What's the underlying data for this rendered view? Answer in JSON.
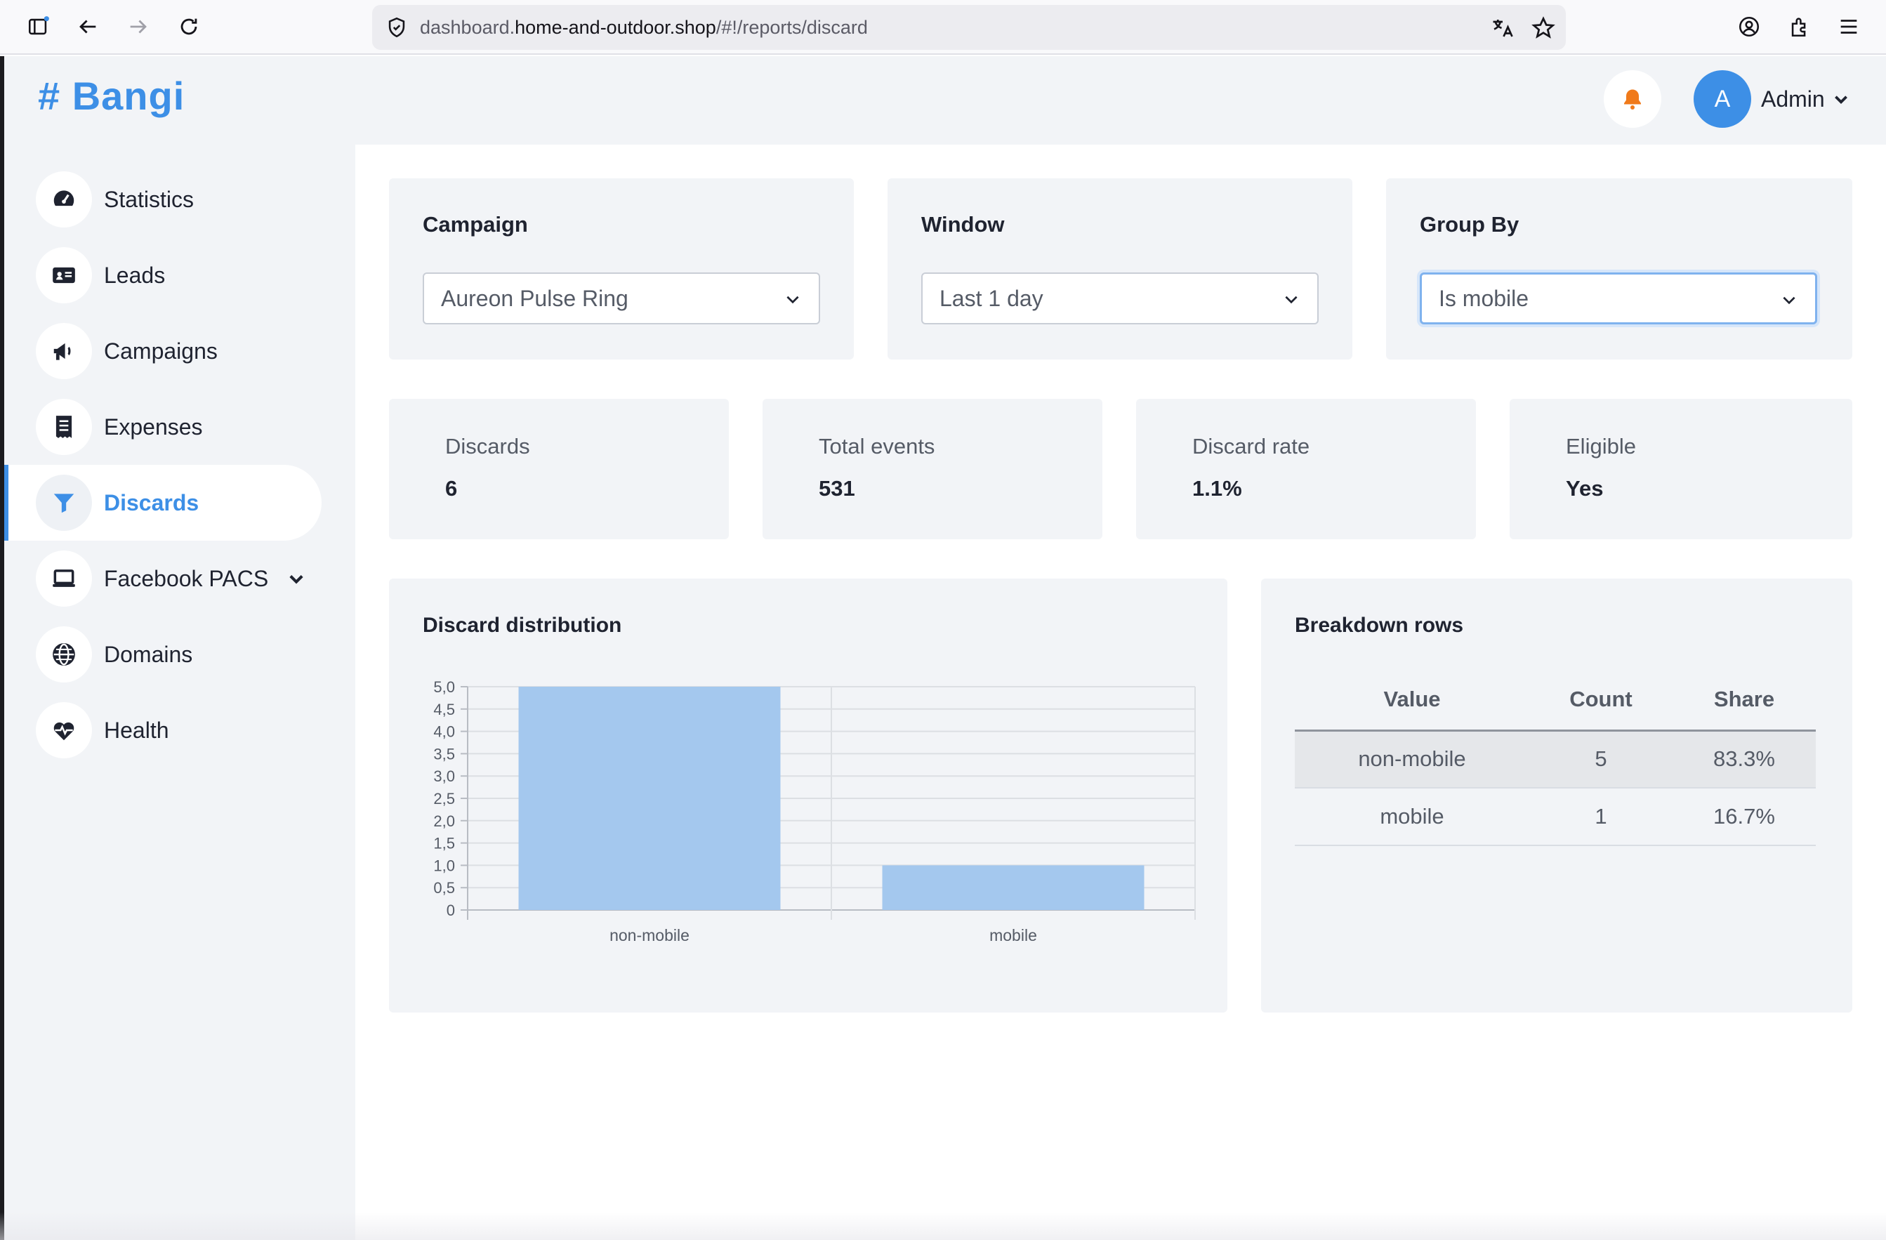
{
  "browser": {
    "url_prefix": "dashboard.",
    "url_host": "home-and-outdoor.shop",
    "url_path": "/#!/reports/discard"
  },
  "header": {
    "logo": "# Bangi",
    "user_initial": "A",
    "user_name": "Admin"
  },
  "sidebar": {
    "items": [
      {
        "label": "Statistics",
        "icon": "gauge-icon"
      },
      {
        "label": "Leads",
        "icon": "id-card-icon"
      },
      {
        "label": "Campaigns",
        "icon": "megaphone-icon"
      },
      {
        "label": "Expenses",
        "icon": "receipt-icon"
      },
      {
        "label": "Discards",
        "icon": "filter-icon",
        "active": true
      },
      {
        "label": "Facebook PACS",
        "icon": "laptop-icon",
        "has_submenu": true
      },
      {
        "label": "Domains",
        "icon": "globe-icon"
      },
      {
        "label": "Health",
        "icon": "heart-pulse-icon"
      }
    ]
  },
  "filters": {
    "campaign": {
      "label": "Campaign",
      "value": "Aureon Pulse Ring"
    },
    "window": {
      "label": "Window",
      "value": "Last 1 day"
    },
    "group_by": {
      "label": "Group By",
      "value": "Is mobile"
    }
  },
  "stats": {
    "discards": {
      "label": "Discards",
      "value": "6"
    },
    "total_events": {
      "label": "Total events",
      "value": "531"
    },
    "discard_rate": {
      "label": "Discard rate",
      "value": "1.1%"
    },
    "eligible": {
      "label": "Eligible",
      "value": "Yes"
    }
  },
  "distribution": {
    "title": "Discard distribution"
  },
  "chart_data": {
    "type": "bar",
    "categories": [
      "non-mobile",
      "mobile"
    ],
    "values": [
      5,
      1
    ],
    "title": "Discard distribution",
    "xlabel": "",
    "ylabel": "",
    "ylim": [
      0,
      5
    ],
    "yticks": [
      "0",
      "0,5",
      "1,0",
      "1,5",
      "2,0",
      "2,5",
      "3,0",
      "3,5",
      "4,0",
      "4,5",
      "5,0"
    ],
    "grid": true,
    "bar_color": "#a4c8ee"
  },
  "breakdown": {
    "title": "Breakdown rows",
    "columns": [
      "Value",
      "Count",
      "Share"
    ],
    "rows": [
      {
        "value": "non-mobile",
        "count": "5",
        "share": "83.3%"
      },
      {
        "value": "mobile",
        "count": "1",
        "share": "16.7%"
      }
    ]
  },
  "colors": {
    "accent": "#3d8fe6",
    "bell": "#f07a1a"
  }
}
